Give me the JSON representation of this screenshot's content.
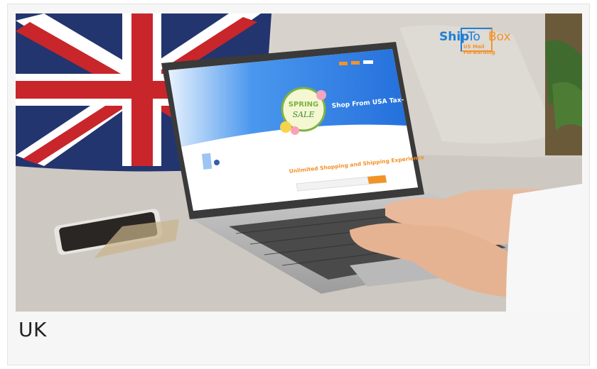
{
  "caption": "UK",
  "photo": {
    "logo": {
      "word1": "Ship",
      "word2": "To",
      "word3": "Box",
      "tagline": "US Mail Forwarding"
    },
    "screen": {
      "spring": "SPRING",
      "sale": "SALE",
      "headline": "Shop From USA Tax-",
      "subheadline": "Unlimited Shopping and Shipping Experience"
    },
    "colors": {
      "logo_blue": "#1e7fd6",
      "logo_orange": "#f2932b",
      "screen_blue": "#2f7fe8",
      "headline_orange": "#f29327"
    }
  }
}
